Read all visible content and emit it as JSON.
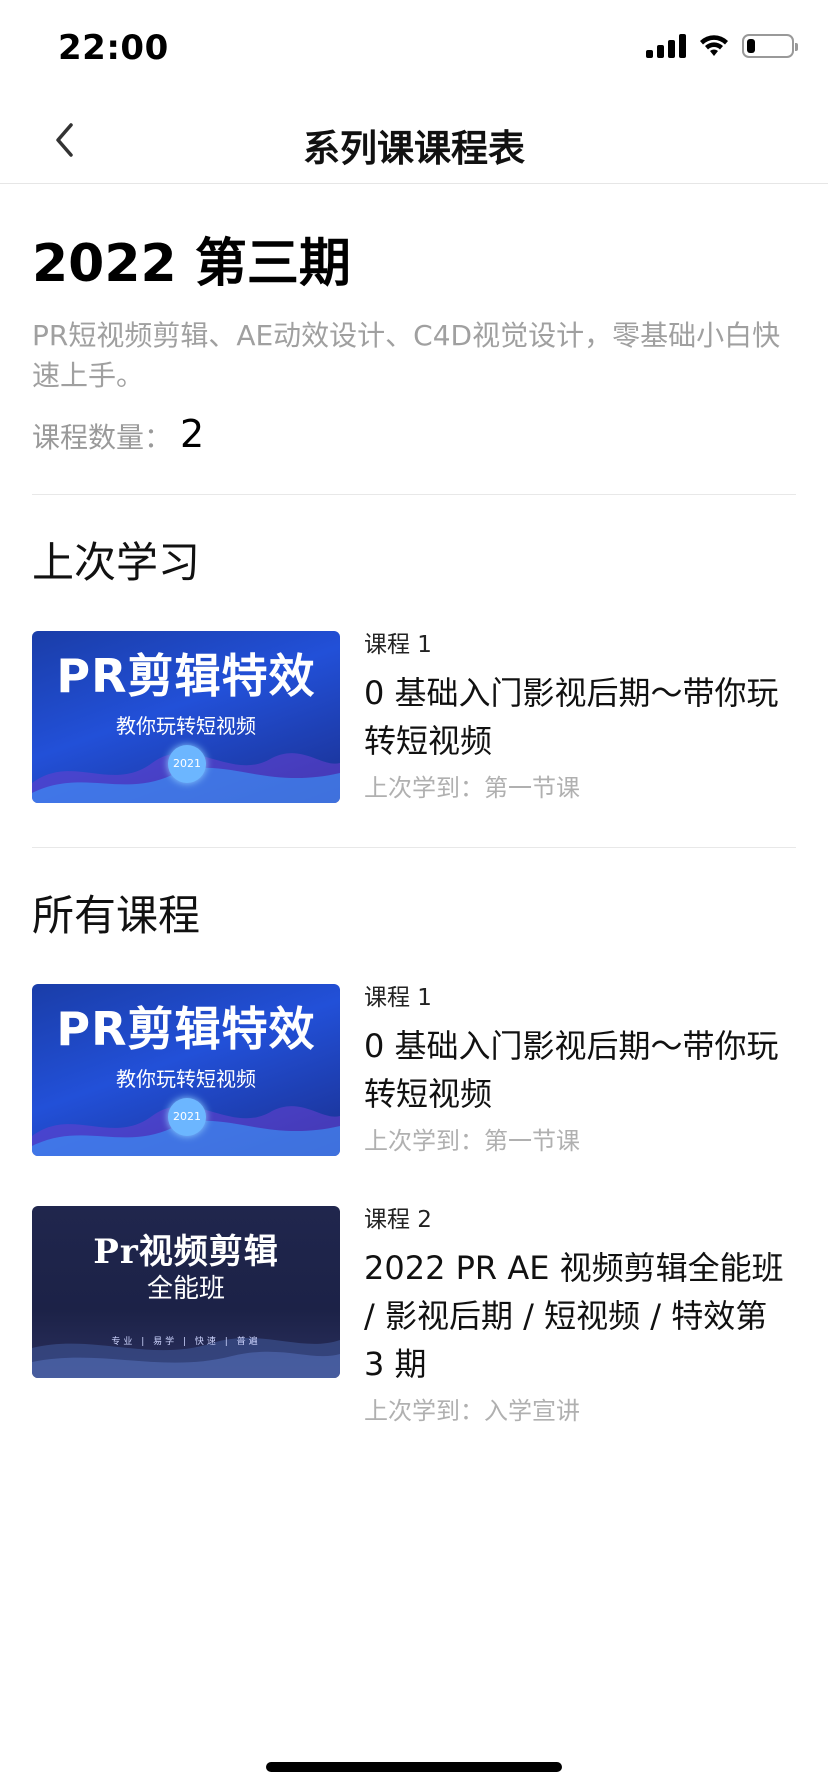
{
  "status_bar": {
    "time": "22:00",
    "battery_level": 0.2
  },
  "nav": {
    "title": "系列课课程表"
  },
  "series": {
    "title": "2022 第三期",
    "description": "PR短视频剪辑、AE动效设计、C4D视觉设计，零基础小白快速上手。",
    "count_label": "课程数量：",
    "count_value": "2"
  },
  "last_study": {
    "section_title": "上次学习",
    "course": {
      "index": "课程 1",
      "title": "0 基础入门影视后期～带你玩转短视频",
      "last": "上次学到：第一节课",
      "thumb": {
        "main": "PR剪辑特效",
        "sub": "教你玩转短视频",
        "badge": "2021"
      }
    }
  },
  "all_courses": {
    "section_title": "所有课程",
    "courses": [
      {
        "index": "课程 1",
        "title": "0 基础入门影视后期～带你玩转短视频",
        "last": "上次学到：第一节课",
        "thumb": {
          "main": "PR剪辑特效",
          "sub": "教你玩转短视频",
          "badge": "2021"
        }
      },
      {
        "index": "课程 2",
        "title": "2022 PR AE 视频剪辑全能班 / 影视后期 / 短视频 / 特效第 3 期",
        "last": "上次学到：入学宣讲",
        "thumb": {
          "main": "Pr视频剪辑",
          "sub": "全能班",
          "tags": "专业 | 易学 | 快速 | 普遍"
        }
      }
    ]
  }
}
